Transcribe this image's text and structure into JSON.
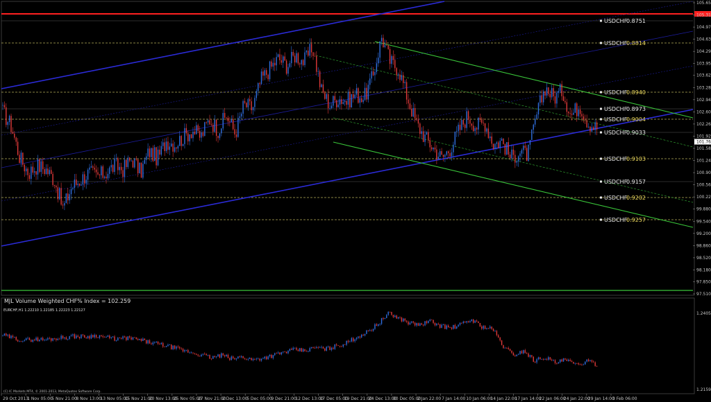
{
  "window": {
    "main_title": "MJL Volume Weighted CHF% Index = 102.259",
    "sub_title": "EURCHF,H1 1.22210 1.22185 1.22223 1.22127",
    "copyright": "(C) IC Markets MT4, © 2001-2013, MetaQuotes Software Corp."
  },
  "colors": {
    "background": "#000000",
    "grid": "#2a2a2a",
    "bull": "#2f6fe0",
    "bear": "#e23a3a",
    "blue_channel": "#2b2bd8",
    "green_channel": "#3ac63a",
    "resistance": "#ff2020",
    "level_dashed": "#b8b05a"
  },
  "chart_data": [
    {
      "type": "line",
      "title": "MJL Volume Weighted CHF% Index = 102.259",
      "ylim": [
        97.51,
        105.65
      ],
      "y_ticks": [
        "105.650",
        "105.310",
        "104.970",
        "104.630",
        "104.290",
        "103.950",
        "103.620",
        "103.280",
        "102.940",
        "102.600",
        "102.260",
        "101.920",
        "101.580",
        "101.240",
        "100.900",
        "100.560",
        "100.220",
        "99.880",
        "99.540",
        "99.200",
        "98.860",
        "98.520",
        "98.180",
        "97.850",
        "97.510"
      ],
      "current_price_label": "101.764",
      "series": [
        {
          "values": [
            102.6,
            102.2,
            101.3,
            100.9,
            101.1,
            101.0,
            100.7,
            99.9,
            100.5,
            100.7,
            100.9,
            100.8,
            100.9,
            101.1,
            101.0,
            101.3,
            100.9,
            101.5,
            101.3,
            101.8,
            101.7,
            101.9,
            102.1,
            101.9,
            102.4,
            102.1,
            102.5,
            102.0,
            102.8,
            102.7,
            103.5,
            103.8,
            104.1,
            103.9,
            104.2,
            104.0,
            104.4,
            103.2,
            102.8,
            103.0,
            102.9,
            103.1,
            103.0,
            103.6,
            104.7,
            104.0,
            103.8,
            103.0,
            102.3,
            101.9,
            101.6,
            101.3,
            101.6,
            102.1,
            102.5,
            102.2,
            102.3,
            101.7,
            101.8,
            101.3,
            101.5,
            101.4,
            102.5,
            103.3,
            103.0,
            103.2,
            102.5,
            102.8,
            102.3,
            102.15
          ]
        }
      ],
      "price_levels": [
        {
          "label": "USDCHF",
          "value": "0.8751",
          "value_color": "#e8e8e8"
        },
        {
          "label": "USDCHF",
          "value": "0.8814",
          "value_color": "#e6d35a"
        },
        {
          "label": "USDCHF",
          "value": "0.8940",
          "value_color": "#e6d35a"
        },
        {
          "label": "USDCHF",
          "value": "0.8973",
          "value_color": "#e8e8e8"
        },
        {
          "label": "USDCHF",
          "value": "0.9004",
          "value_color": "#e6d35a"
        },
        {
          "label": "USDCHF",
          "value": "0.9033",
          "value_color": "#e8e8e8"
        },
        {
          "label": "USDCHF",
          "value": "0.9103",
          "value_color": "#e6d35a"
        },
        {
          "label": "USDCHF",
          "value": "0.9157",
          "value_color": "#e8e8e8"
        },
        {
          "label": "USDCHF",
          "value": "0.9202",
          "value_color": "#e6d35a"
        },
        {
          "label": "USDCHF",
          "value": "0.9257",
          "value_color": "#e6d35a"
        }
      ]
    },
    {
      "type": "line",
      "title": "EURCHF,H1 1.22210 1.22185 1.22223 1.22127",
      "ylim": [
        1.21594,
        1.24056
      ],
      "y_ticks": [
        "1.24056",
        "1.21594"
      ],
      "series": [
        {
          "values": [
            1.2335,
            1.2325,
            1.2318,
            1.2322,
            1.232,
            1.2325,
            1.2328,
            1.2332,
            1.233,
            1.2334,
            1.2327,
            1.2322,
            1.2326,
            1.232,
            1.2312,
            1.2305,
            1.2298,
            1.2288,
            1.228,
            1.2272,
            1.2262,
            1.227,
            1.2258,
            1.2265,
            1.2255,
            1.2262,
            1.227,
            1.228,
            1.2288,
            1.2284,
            1.2295,
            1.229,
            1.23,
            1.231,
            1.233,
            1.2345,
            1.2372,
            1.2405,
            1.239,
            1.2375,
            1.2368,
            1.238,
            1.2365,
            1.2358,
            1.237,
            1.2385,
            1.2362,
            1.2355,
            1.23,
            1.227,
            1.2285,
            1.2252,
            1.2265,
            1.2245,
            1.2255,
            1.2238,
            1.225,
            1.224
          ]
        }
      ]
    }
  ],
  "x_axis": {
    "labels": [
      "29 Oct 2013",
      "1 Nov 05:00",
      "5 Nov 21:00",
      "8 Nov 13:00",
      "13 Nov 05:00",
      "15 Nov 21:00",
      "20 Nov 13:00",
      "25 Nov 05:00",
      "27 Nov 21:00",
      "2 Dec 13:00",
      "5 Dec 05:00",
      "9 Dec 21:00",
      "12 Dec 13:00",
      "17 Dec 05:00",
      "19 Dec 21:00",
      "24 Dec 13:00",
      "30 Dec 05:00",
      "2 Jan 22:00",
      "7 Jan 14:00",
      "10 Jan 06:00",
      "14 Jan 22:00",
      "17 Jan 14:00",
      "22 Jan 06:00",
      "24 Jan 22:00",
      "29 Jan 14:00",
      "3 Feb 06:00"
    ]
  }
}
